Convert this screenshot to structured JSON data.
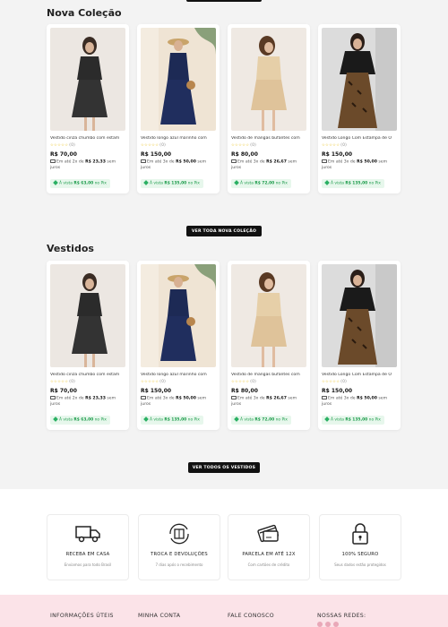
{
  "sections": [
    {
      "title": "Nova Coleção",
      "button": "VER TODA NOVA COLEÇÃO",
      "products": [
        {
          "name": "Vestido cinza chumbo com estam",
          "rating_count": "(0)",
          "price": "R$ 70,00",
          "inst_pre": "Em até 2x de",
          "inst_val": "R$ 23,33",
          "inst_post": "sem juros",
          "pix_pre": "À vista",
          "pix_val": "R$ 63,00",
          "pix_post": "no Pix"
        },
        {
          "name": "Vestido longo azul marinho com",
          "rating_count": "(0)",
          "price": "R$ 150,00",
          "inst_pre": "Em até 3x de",
          "inst_val": "R$ 50,00",
          "inst_post": "sem juros",
          "pix_pre": "À vista",
          "pix_val": "R$ 135,00",
          "pix_post": "no Pix"
        },
        {
          "name": "Vestido de mangas bufantes com",
          "rating_count": "(0)",
          "price": "R$ 80,00",
          "inst_pre": "Em até 3x de",
          "inst_val": "R$ 26,67",
          "inst_post": "sem juros",
          "pix_pre": "À vista",
          "pix_val": "R$ 72,00",
          "pix_post": "no Pix"
        },
        {
          "name": "Vestido Longo Com Estampa de O",
          "rating_count": "(0)",
          "price": "R$ 150,00",
          "inst_pre": "Em até 3x de",
          "inst_val": "R$ 50,00",
          "inst_post": "sem juros",
          "pix_pre": "À vista",
          "pix_val": "R$ 135,00",
          "pix_post": "no Pix"
        }
      ]
    },
    {
      "title": "Vestidos",
      "button": "VER TODOS OS VESTIDOS",
      "products": [
        {
          "name": "Vestido cinza chumbo com estam",
          "rating_count": "(0)",
          "price": "R$ 70,00",
          "inst_pre": "Em até 2x de",
          "inst_val": "R$ 23,33",
          "inst_post": "sem juros",
          "pix_pre": "À vista",
          "pix_val": "R$ 63,00",
          "pix_post": "no Pix"
        },
        {
          "name": "Vestido longo azul marinho com",
          "rating_count": "(0)",
          "price": "R$ 150,00",
          "inst_pre": "Em até 3x de",
          "inst_val": "R$ 50,00",
          "inst_post": "sem juros",
          "pix_pre": "À vista",
          "pix_val": "R$ 135,00",
          "pix_post": "no Pix"
        },
        {
          "name": "Vestido de mangas bufantes com",
          "rating_count": "(0)",
          "price": "R$ 80,00",
          "inst_pre": "Em até 3x de",
          "inst_val": "R$ 26,67",
          "inst_post": "sem juros",
          "pix_pre": "À vista",
          "pix_val": "R$ 72,00",
          "pix_post": "no Pix"
        },
        {
          "name": "Vestido Longo Com Estampa de O",
          "rating_count": "(0)",
          "price": "R$ 150,00",
          "inst_pre": "Em até 3x de",
          "inst_val": "R$ 50,00",
          "inst_post": "sem juros",
          "pix_pre": "À vista",
          "pix_val": "R$ 135,00",
          "pix_post": "no Pix"
        }
      ]
    }
  ],
  "features": [
    {
      "icon": "truck-icon",
      "title": "RECEBA EM CASA",
      "subtitle": "Enviamos para todo Brasil"
    },
    {
      "icon": "box-return-icon",
      "title": "TROCA E DEVOLUÇÕES",
      "subtitle": "7 dias após o recebimento"
    },
    {
      "icon": "credit-card-icon",
      "title": "PARCELA EM ATÉ 12X",
      "subtitle": "Com cartões de crédito"
    },
    {
      "icon": "padlock-icon",
      "title": "100% SEGURO",
      "subtitle": "Seus dados estão protegidos"
    }
  ],
  "footer": {
    "col1": "INFORMAÇÕES ÚTEIS",
    "col2": "MINHA CONTA",
    "col3": "FALE CONOSCO",
    "col4": "NOSSAS REDES:"
  },
  "colors": {
    "accent": "#111111",
    "pix_green": "#1b9b4a",
    "footer_bg": "#fbe3e8"
  }
}
